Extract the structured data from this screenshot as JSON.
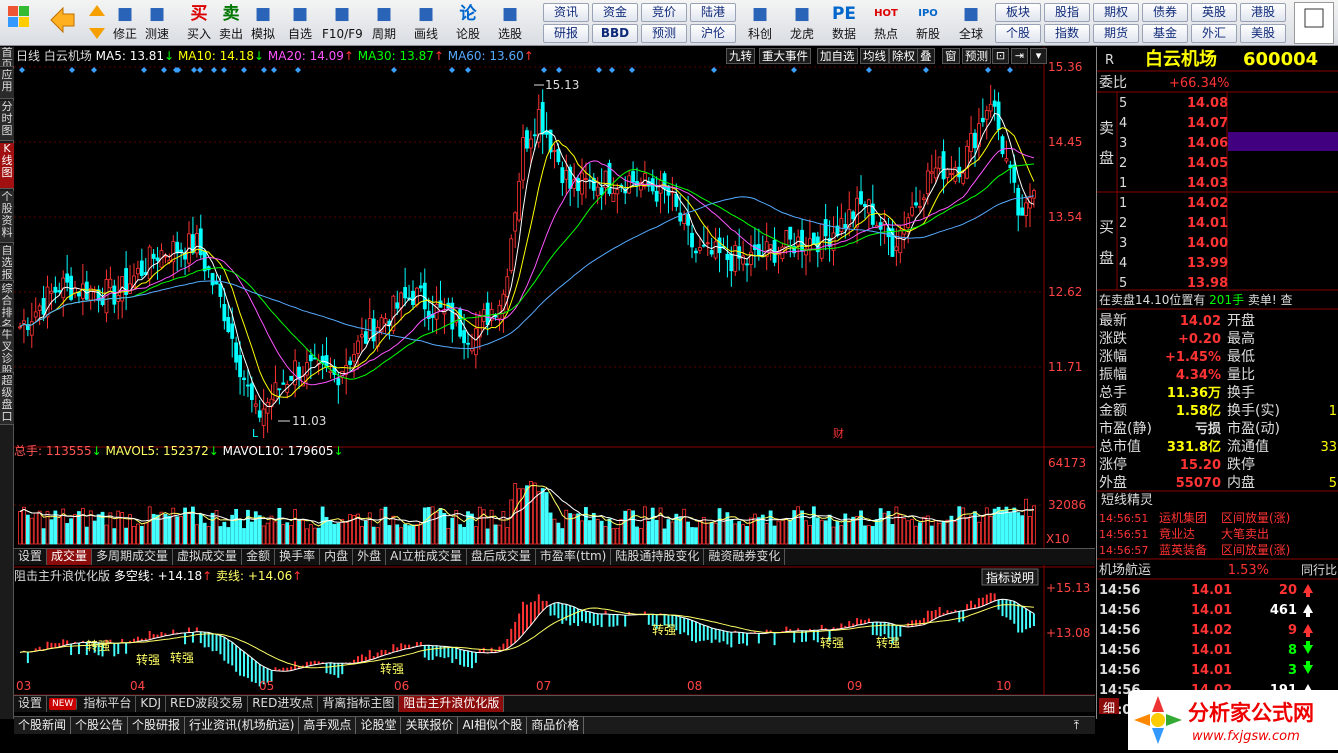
{
  "toolbar": {
    "buttons": [
      {
        "label": "修正",
        "icon": "refresh-icon"
      },
      {
        "label": "测速",
        "icon": "speed-icon"
      },
      {
        "label": "买入",
        "icon": "buy-icon",
        "glyph": "买"
      },
      {
        "label": "卖出",
        "icon": "sell-icon",
        "glyph": "卖"
      },
      {
        "label": "模拟",
        "icon": "gavel-icon"
      },
      {
        "label": "自选",
        "icon": "house-icon"
      },
      {
        "label": "F10/F9",
        "icon": "f10-icon"
      },
      {
        "label": "周期",
        "icon": "period-icon"
      },
      {
        "label": "画线",
        "icon": "pencil-icon"
      },
      {
        "label": "论股",
        "icon": "discuss-icon",
        "glyph": "论"
      },
      {
        "label": "选股",
        "icon": "select-icon"
      }
    ],
    "menu_buttons": [
      [
        "资讯",
        "资金",
        "竞价",
        "陆港"
      ],
      [
        "研报",
        "BBD",
        "预测",
        "沪伦"
      ]
    ],
    "buttons2": [
      {
        "label": "科创",
        "icon": "sci-icon"
      },
      {
        "label": "龙虎",
        "icon": "dragon-icon"
      },
      {
        "label": "数据",
        "icon": "pe-icon",
        "glyph": "PE"
      },
      {
        "label": "热点",
        "icon": "hot-icon",
        "glyph": "HOT"
      },
      {
        "label": "新股",
        "icon": "ipo-icon",
        "glyph": "IPO"
      },
      {
        "label": "全球",
        "icon": "globe-icon"
      }
    ],
    "menu_buttons2": [
      [
        "板块",
        "股指",
        "期权",
        "债券",
        "英股",
        "港股"
      ],
      [
        "个股",
        "指数",
        "期货",
        "基金",
        "外汇",
        "美股"
      ]
    ]
  },
  "sidebar": {
    "tabs": [
      "首页",
      "应用",
      "分时图",
      "K线图",
      "个股资料",
      "自选报",
      "综合排名",
      "牛叉诊股",
      "超级盘口"
    ],
    "active": "K线图"
  },
  "chart": {
    "period": "日线",
    "stock_name": "白云机场",
    "ma": [
      {
        "label": "MA5: 13.81",
        "arrow": "↓",
        "color": "#ffffff"
      },
      {
        "label": "MA10: 14.18",
        "arrow": "↓",
        "color": "#ffff00"
      },
      {
        "label": "MA20: 14.09",
        "arrow": "↑",
        "color": "#ff55ff"
      },
      {
        "label": "MA30: 13.87",
        "arrow": "↑",
        "color": "#00ff00"
      },
      {
        "label": "MA60: 13.60",
        "arrow": "↑",
        "color": "#55aaff"
      }
    ],
    "tools": [
      "九转",
      "重大事件",
      "加自选",
      "均线",
      "除权",
      "叠",
      "窗",
      "预测"
    ],
    "y_labels": [
      "15.36",
      "14.45",
      "13.54",
      "12.62",
      "11.71"
    ],
    "high_label": "15.13",
    "low_label": "11.03",
    "marker_L": "L",
    "marker_cai": "财",
    "volume": {
      "label": "总手: 113555",
      "mavol5": "MAVOL5: 152372",
      "mavol10": "MAVOL10: 179605",
      "y_labels": [
        "64173",
        "32086"
      ],
      "unit": "X10"
    },
    "vol_tabs": [
      "设置",
      "成交量",
      "多周期成交量",
      "虚拟成交量",
      "金额",
      "换手率",
      "内盘",
      "外盘",
      "AI立桩成交量",
      "盘后成交量",
      "市盈率(ttm)",
      "陆股通持股变化",
      "融资融券变化"
    ],
    "vol_tab_active": "成交量",
    "indicator": {
      "title": "阻击主升浪优化版",
      "line1": "多空线: +14.18",
      "line2": "卖线: +14.06",
      "explain_button": "指标说明",
      "y_labels": [
        "15.13",
        "13.08"
      ],
      "signal": "转强",
      "signal_count": 6
    },
    "x_labels": [
      "03",
      "04",
      "05",
      "06",
      "07",
      "08",
      "09",
      "10"
    ],
    "ind_tabs": [
      "设置",
      "指标平台",
      "KDJ",
      "RED波段交易",
      "RED进攻点",
      "背离指标主图",
      "阻击主升浪优化版"
    ],
    "ind_tab_new": "NEW",
    "ind_tab_active": "阻击主升浪优化版"
  },
  "bottom_tabs": [
    "个股新闻",
    "个股公告",
    "个股研报",
    "行业资讯(机场航运)",
    "高手观点",
    "论股堂",
    "关联报价",
    "AI相似个股",
    "商品价格"
  ],
  "quote": {
    "market": "R",
    "name": "白云机场",
    "code": "600004",
    "weibi_label": "委比",
    "weibi": "+66.34%",
    "sell_label": "卖盘",
    "buy_label": "买盘",
    "sell": [
      [
        "5",
        "14.08"
      ],
      [
        "4",
        "14.07"
      ],
      [
        "3",
        "14.06"
      ],
      [
        "2",
        "14.05"
      ],
      [
        "1",
        "14.03"
      ]
    ],
    "buy": [
      [
        "1",
        "14.02"
      ],
      [
        "2",
        "14.01"
      ],
      [
        "3",
        "14.00"
      ],
      [
        "4",
        "13.99"
      ],
      [
        "5",
        "13.98"
      ]
    ],
    "notice_prefix": "在卖盘14.10位置有",
    "notice_qty": "201手",
    "notice_suffix": "卖单!",
    "notice_link": "查",
    "stats": [
      [
        "最新",
        "14.02",
        "开盘",
        ""
      ],
      [
        "涨跌",
        "+0.20",
        "最高",
        ""
      ],
      [
        "涨幅",
        "+1.45%",
        "最低",
        ""
      ],
      [
        "振幅",
        "4.34%",
        "量比",
        ""
      ],
      [
        "总手",
        "11.36万",
        "换手",
        ""
      ],
      [
        "金额",
        "1.58亿",
        "换手(实)",
        "1"
      ],
      [
        "市盈(静)",
        "亏损",
        "市盈(动)",
        ""
      ],
      [
        "总市值",
        "331.8亿",
        "流通值",
        "33"
      ],
      [
        "涨停",
        "15.20",
        "跌停",
        ""
      ],
      [
        "外盘",
        "55070",
        "内盘",
        "5"
      ]
    ],
    "short_title": "短线精灵",
    "short_rows": [
      [
        "14:56:51",
        "运机集团",
        "区间放量(涨)"
      ],
      [
        "14:56:51",
        "竟业达",
        "大笔卖出"
      ],
      [
        "14:56:57",
        "蓝英装备",
        "区间放量(涨)"
      ]
    ],
    "sector_name": "机场航运",
    "sector_pct": "1.53%",
    "sector_link": "同行比",
    "ticks": [
      [
        "14:56",
        "14.01",
        "20",
        "up"
      ],
      [
        "14:56",
        "14.01",
        "461",
        "up"
      ],
      [
        "14:56",
        "14.02",
        "9",
        "up"
      ],
      [
        "14:56",
        "14.01",
        "8",
        "down"
      ],
      [
        "14:56",
        "14.01",
        "3",
        "down"
      ],
      [
        "14:56",
        "14.02",
        "191",
        "up"
      ],
      [
        "15:00",
        "",
        "",
        ""
      ]
    ],
    "detail_tab": "细"
  },
  "watermark": {
    "text": "分析家公式网",
    "url": "www.fxjgsw.com"
  },
  "colors": {
    "up": "#ff3333",
    "down": "#00ffff",
    "yellow": "#ffff00",
    "accent": "#400080"
  }
}
